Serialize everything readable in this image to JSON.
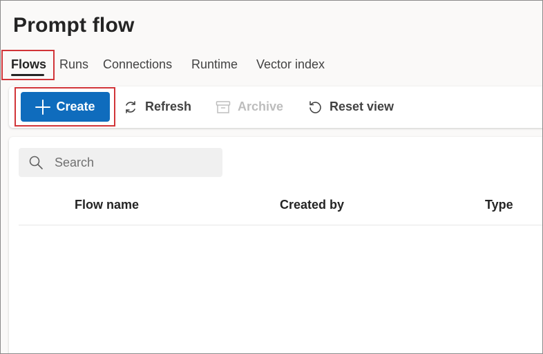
{
  "page": {
    "title": "Prompt flow"
  },
  "tabs": [
    {
      "label": "Flows",
      "active": true
    },
    {
      "label": "Runs",
      "active": false
    },
    {
      "label": "Connections",
      "active": false
    },
    {
      "label": "Runtime",
      "active": false
    },
    {
      "label": "Vector index",
      "active": false
    }
  ],
  "toolbar": {
    "create_label": "Create",
    "refresh_label": "Refresh",
    "archive_label": "Archive",
    "reset_view_label": "Reset view"
  },
  "search": {
    "placeholder": "Search",
    "value": ""
  },
  "table": {
    "columns": [
      "Flow name",
      "Created by",
      "Type"
    ],
    "rows": []
  },
  "icons": {
    "create": "plus-icon",
    "refresh": "refresh-icon",
    "archive": "archive-icon",
    "reset_view": "reset-icon",
    "search": "search-icon"
  },
  "colors": {
    "primary": "#0f6cbd",
    "highlight": "#d13438",
    "disabled_text": "#bdbdbd"
  }
}
